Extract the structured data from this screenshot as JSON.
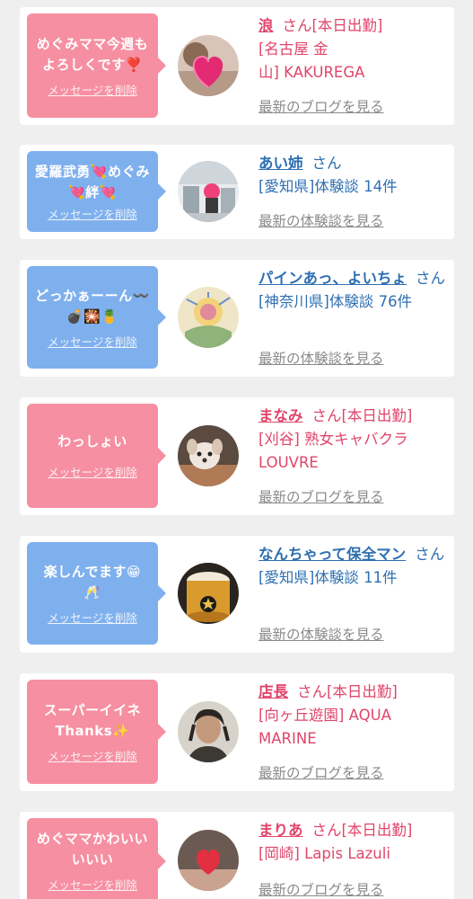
{
  "items": [
    {
      "message": "めぐみママ今週も\nよろしくです❣️",
      "delete_label": "メッセージを削除",
      "avatar": "heart-sticker-photo",
      "name": "浪",
      "honorific": "さん",
      "status": "[本日出勤]",
      "detail": "[名古屋 金\n山] KAKUREGA",
      "link": "最新のブログを見る",
      "type": "cast",
      "color": "#f68fa1"
    },
    {
      "message": "愛羅武勇💘めぐみ\n💘絆💘",
      "delete_label": "メッセージを削除",
      "avatar": "pink-hair-mall-photo",
      "name": "あい姉",
      "honorific": "さん",
      "status": "",
      "detail": "[愛知県]体験談 14件",
      "link": "最新の体験談を見る",
      "type": "user",
      "color": "#7fb0ee"
    },
    {
      "message": "どっかぁーーん〰️\n💣🎇🍍",
      "delete_label": "メッセージを削除",
      "avatar": "drawing-photo",
      "name": "パインあっ、よいちょ",
      "honorific": "さん",
      "status": "",
      "detail": "[神奈川県]体験談 76件",
      "link": "最新の体験談を見る",
      "type": "user",
      "color": "#7fb0ee"
    },
    {
      "message": "わっしょい",
      "delete_label": "メッセージを削除",
      "avatar": "puppy-photo",
      "name": "まなみ",
      "honorific": "さん",
      "status": "[本日出勤]",
      "detail": "[刈谷] 熟女キャバクラ\nLOUVRE",
      "link": "最新のブログを見る",
      "type": "cast",
      "color": "#f68fa1"
    },
    {
      "message": "楽しんでます😁\n🥂",
      "delete_label": "メッセージを削除",
      "avatar": "beer-glass-photo",
      "name": "なんちゃって保全マン",
      "honorific": "さん",
      "status": "",
      "detail": "[愛知県]体験談 11件",
      "link": "最新の体験談を見る",
      "type": "user",
      "color": "#7fb0ee"
    },
    {
      "message": "スーパーイイネ\nThanks✨",
      "delete_label": "メッセージを削除",
      "avatar": "man-portrait-photo",
      "name": "店長",
      "honorific": "さん",
      "status": "[本日出勤]",
      "detail": "[向ヶ丘遊園] AQUA\nMARINE",
      "link": "最新のブログを見る",
      "type": "cast",
      "color": "#f68fa1"
    },
    {
      "message": "めぐママかわいい\nいいい",
      "delete_label": "メッセージを削除",
      "avatar": "heart-face-photo",
      "name": "まりあ",
      "honorific": "さん",
      "status": "[本日出勤]",
      "detail": "[岡崎] Lapis Lazuli",
      "link": "最新のブログを見る",
      "type": "cast",
      "color": "#f68fa1"
    }
  ]
}
